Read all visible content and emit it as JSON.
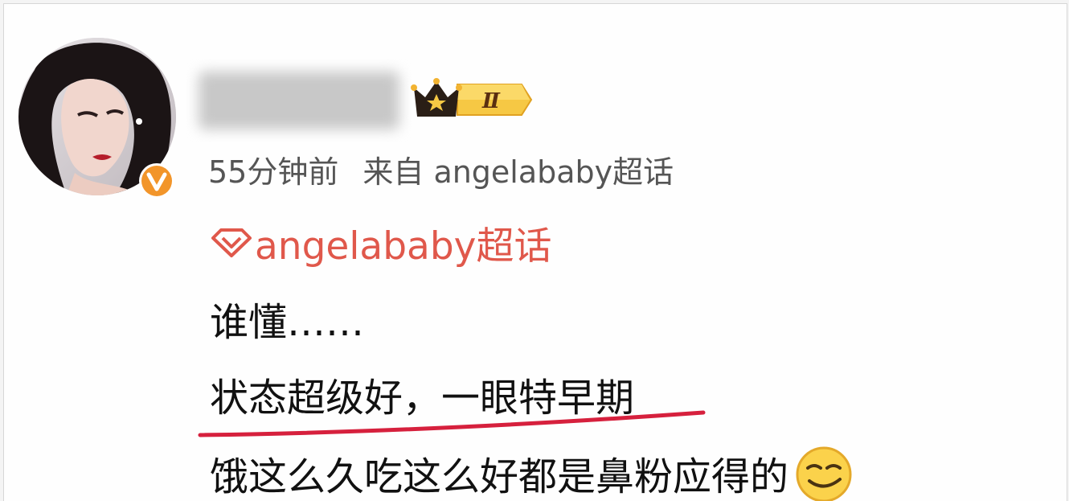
{
  "post": {
    "meta": {
      "time": "55分钟前",
      "source": "来自 angelababy超话"
    },
    "topic": {
      "label": "angelababy超话",
      "icon": "supertopic-diamond-icon",
      "color": "#e0584b"
    },
    "badge": {
      "icon": "crown-icon",
      "level": "Ⅱ"
    },
    "verified_icon": "verified-v-icon",
    "content": {
      "line1": "谁懂……",
      "line2": "状态超级好，一眼特早期",
      "line3": "饿这么久吃这么好都是鼻粉应得的"
    },
    "emoji_icon": "smirk-emoji-icon",
    "accent_colors": {
      "underline": "#d6203d",
      "verified": "#f2952a",
      "crown_gold": "#f4c236"
    }
  }
}
